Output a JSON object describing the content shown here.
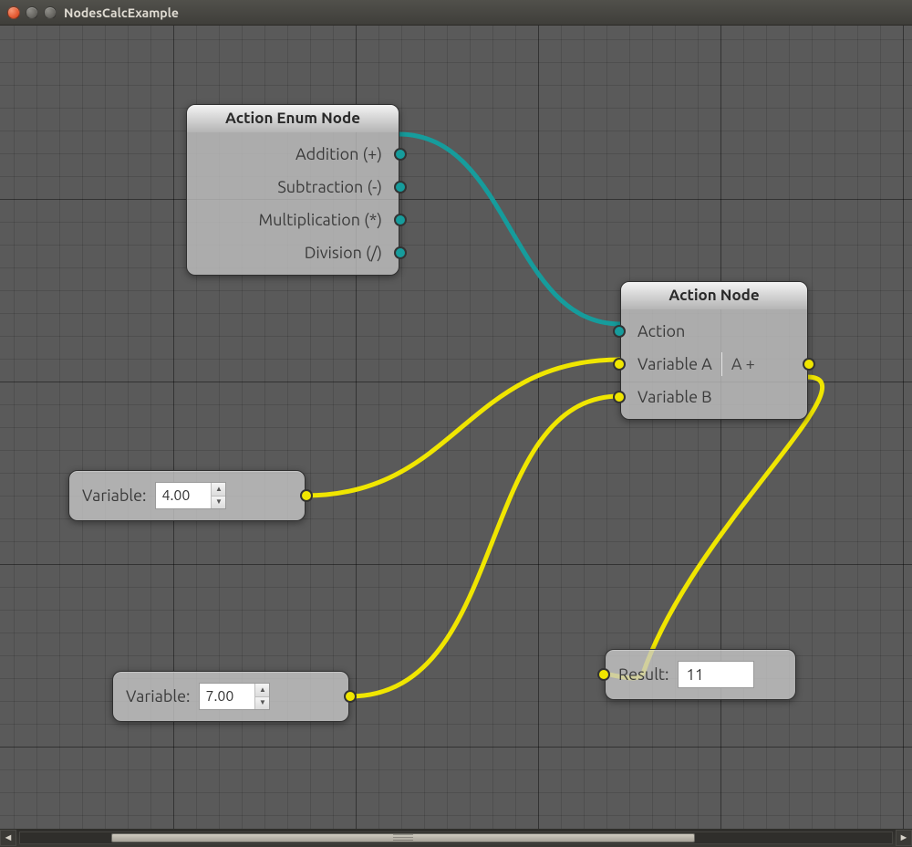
{
  "window": {
    "title": "NodesCalcExample"
  },
  "enum_node": {
    "title": "Action Enum Node",
    "rows": [
      {
        "label": "Addition (+)"
      },
      {
        "label": "Subtraction (-)"
      },
      {
        "label": "Multiplication (*)"
      },
      {
        "label": "Division (/)"
      }
    ]
  },
  "action_node": {
    "title": "Action Node",
    "inputs": {
      "action": "Action",
      "a": "Variable A",
      "b": "Variable B"
    },
    "expr": "A +"
  },
  "var_a": {
    "label": "Variable:",
    "value": "4.00"
  },
  "var_b": {
    "label": "Variable:",
    "value": "7.00"
  },
  "result": {
    "label": "Result:",
    "value": "11"
  }
}
